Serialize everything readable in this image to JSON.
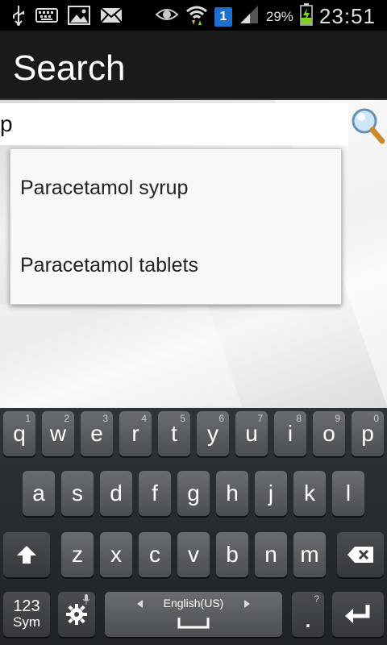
{
  "status_bar": {
    "battery_percent": "29%",
    "time": "23:51",
    "notification_count": "1",
    "icons": [
      "usb-icon",
      "keyboard-icon",
      "image-icon",
      "mail-icon",
      "eye-icon",
      "wifi-icon",
      "signal-icon",
      "battery-icon"
    ]
  },
  "action_bar": {
    "title": "Search"
  },
  "search": {
    "value": "p",
    "suggestions": [
      "Paracetamol syrup",
      "Paracetamol tablets"
    ]
  },
  "keyboard": {
    "row1": [
      {
        "label": "q",
        "hint": "1"
      },
      {
        "label": "w",
        "hint": "2"
      },
      {
        "label": "e",
        "hint": "3"
      },
      {
        "label": "r",
        "hint": "4"
      },
      {
        "label": "t",
        "hint": "5"
      },
      {
        "label": "y",
        "hint": "6"
      },
      {
        "label": "u",
        "hint": "7"
      },
      {
        "label": "i",
        "hint": "8"
      },
      {
        "label": "o",
        "hint": "9"
      },
      {
        "label": "p",
        "hint": "0"
      }
    ],
    "row2": [
      "a",
      "s",
      "d",
      "f",
      "g",
      "h",
      "j",
      "k",
      "l"
    ],
    "row3": [
      "z",
      "x",
      "c",
      "v",
      "b",
      "n",
      "m"
    ],
    "sym_top": "123",
    "sym_bottom": "Sym",
    "language": "English(US)",
    "period": ".",
    "period_hint": "?"
  }
}
